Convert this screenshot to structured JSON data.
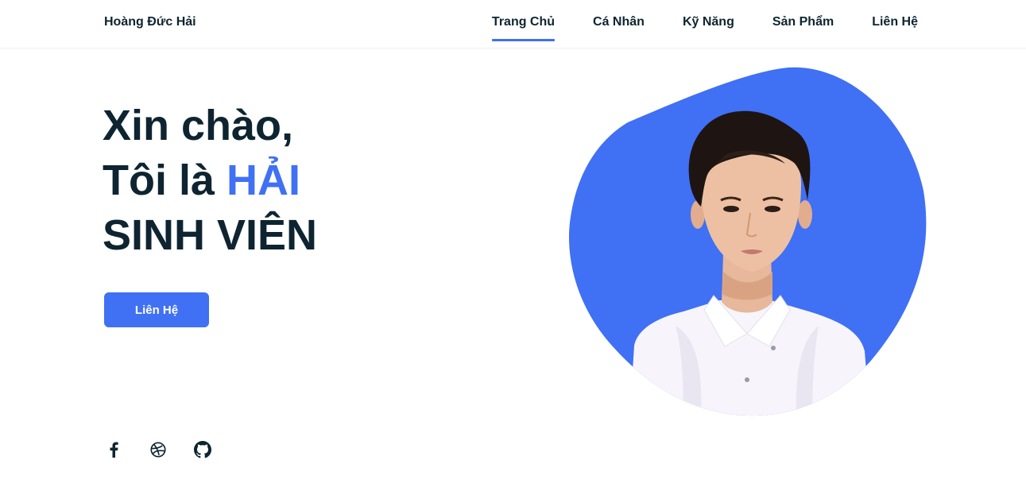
{
  "header": {
    "logo": "Hoàng Đức Hải",
    "nav": [
      {
        "label": "Trang Chủ",
        "active": true
      },
      {
        "label": "Cá Nhân",
        "active": false
      },
      {
        "label": "Kỹ Năng",
        "active": false
      },
      {
        "label": "Sản Phẩm",
        "active": false
      },
      {
        "label": "Liên Hệ",
        "active": false
      }
    ]
  },
  "hero": {
    "line1": "Xin chào,",
    "line2_prefix": "Tôi là ",
    "line2_name": "HẢI",
    "line3": "SINH VIÊN",
    "button_label": "Liên Hệ"
  },
  "socials": [
    {
      "icon": "facebook-icon"
    },
    {
      "icon": "dribbble-icon"
    },
    {
      "icon": "github-icon"
    }
  ],
  "colors": {
    "accent": "#4070f4",
    "text": "#0e2431",
    "background": "#ffffff"
  }
}
